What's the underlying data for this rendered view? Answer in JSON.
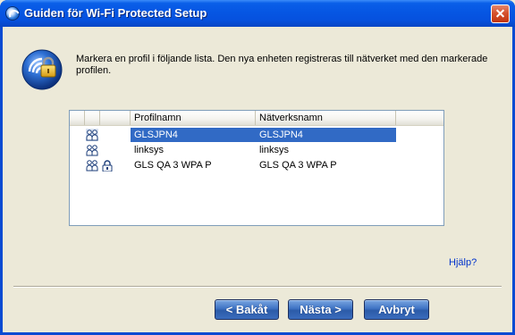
{
  "window": {
    "title": "Guiden för Wi-Fi Protected Setup",
    "icons": {
      "app": "wifi-setup-app-icon",
      "close": "close-icon"
    }
  },
  "header": {
    "icon": "wps-lock-icon",
    "instruction": "Markera en profil i följande lista. Den nya enheten registreras till nätverket med den markerade profilen."
  },
  "profile_list": {
    "columns": [
      "",
      "",
      "",
      "Profilnamn",
      "Nätverksnamn",
      ""
    ],
    "rows": [
      {
        "profile": "GLSJPN4",
        "network": "GLSJPN4",
        "icons": [
          "users-icon"
        ],
        "selected": true
      },
      {
        "profile": "linksys",
        "network": "linksys",
        "icons": [
          "users-icon"
        ],
        "selected": false
      },
      {
        "profile": "GLS QA 3 WPA P",
        "network": "GLS QA 3 WPA P",
        "icons": [
          "users-icon",
          "lock-icon"
        ],
        "selected": false
      }
    ]
  },
  "links": {
    "help": "Hjälp?"
  },
  "buttons": {
    "back": "< Bakåt",
    "next": "Nästa >",
    "cancel": "Avbryt"
  },
  "colors": {
    "title_bar": "#0656e3",
    "selection": "#316ac5",
    "button": "#3e73c4",
    "link": "#0033cc",
    "dialog_background": "#ece9d8"
  }
}
